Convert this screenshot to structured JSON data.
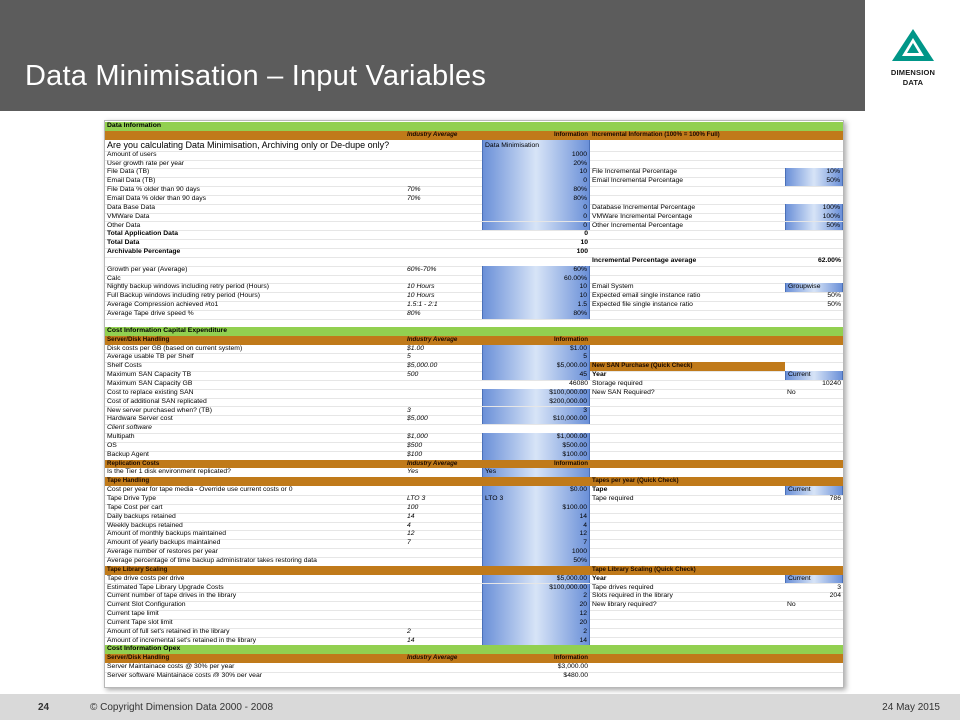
{
  "slide": {
    "title": "Data Minimisation – Input Variables",
    "logo_text_1": "DIMENSION",
    "logo_text_2": "DATA",
    "page_number": "24",
    "copyright": "© Copyright Dimension Data 2000 - 2008",
    "date": "24 May 2015"
  },
  "colors": {
    "header": "#5c5c5c",
    "green": "#92d050",
    "orange": "#c07a1a",
    "logo": "#009688"
  },
  "rows": [
    {
      "t": "g",
      "c1": "Data Information"
    },
    {
      "t": "o",
      "c2": "Industry Average",
      "c3": "Information",
      "c4": "Incremental Information (100% = 100% Full)"
    },
    {
      "t": "q",
      "c1": "Are you calculating Data Minimisation, Archiving only or De-dupe only?",
      "c3": "Data Minimisation",
      "c3b": 1,
      "c3l": 1
    },
    {
      "c1": "Amount of users",
      "c3": "1000",
      "c3b": 1
    },
    {
      "c1": "User growth rate per year",
      "c3": "20%",
      "c3b": 1
    },
    {
      "c1": "File Data (TB)",
      "c3": "10",
      "c3b": 1,
      "c4": "File Incremental Percentage",
      "c5": "10%",
      "c5b": 1
    },
    {
      "c1": "Email Data (TB)",
      "c3": "0",
      "c3b": 1,
      "c4": "Email Incremental Percentage",
      "c5": "50%",
      "c5b": 1
    },
    {
      "c1": "File Data % older than 90 days",
      "c2": "70%",
      "c3": "80%",
      "c3b": 1
    },
    {
      "c1": "Email Data % older than 90 days",
      "c2": "70%",
      "c3": "80%",
      "c3b": 1
    },
    {
      "c1": "Data Base Data",
      "c3": "0",
      "c3b": 1,
      "c4": "Database Incremental Percentage",
      "c5": "100%",
      "c5b": 1
    },
    {
      "c1": "VMWare Data",
      "c3": "0",
      "c3b": 1,
      "c4": "VMWare Incremental Percentage",
      "c5": "100%",
      "c5b": 1
    },
    {
      "c1": "Other Data",
      "c3": "0",
      "c3b": 1,
      "c4": "Other Incremental Percentage",
      "c5": "50%",
      "c5b": 1
    },
    {
      "c1": "Total Application Data",
      "c3": "0",
      "bold": 1
    },
    {
      "c1": "Total Data",
      "c3": "10",
      "bold": 1
    },
    {
      "c1": "Archivable Percentage",
      "c3": "100",
      "bold": 1
    },
    {
      "c4": "Incremental Percentage average",
      "c5": "62.00%",
      "bold": 1
    },
    {
      "c1": "Growth per year (Average)",
      "c2": "60%-70%",
      "c3": "60%",
      "c3b": 1
    },
    {
      "c1": "Calc",
      "c3": "60.00%",
      "c3b": 1
    },
    {
      "c1": "Nightly backup windows including retry period (Hours)",
      "c2": "10 Hours",
      "c3": "10",
      "c3b": 1,
      "c4": "Email System",
      "c5": "Groupwise",
      "c5b": 1,
      "c5l": 1
    },
    {
      "c1": "Full Backup windows including retry period (Hours)",
      "c2": "10 Hours",
      "c3": "10",
      "c3b": 1,
      "c4": "Expected email single instance ratio",
      "c5": "50%"
    },
    {
      "c1": "Average Compression achieved #to1",
      "c2": "1.5:1 - 2:1",
      "c3": "1.5",
      "c3b": 1,
      "c4": "Expected file single instance ratio",
      "c5": "50%"
    },
    {
      "c1": "Average Tape drive speed %",
      "c2": "80%",
      "c3": "80%",
      "c3b": 1
    },
    {},
    {
      "t": "g",
      "c1": "Cost Information Capital Expenditure"
    },
    {
      "t": "o",
      "c1": "Server/Disk Handling",
      "c2": "Industry Average",
      "c3": "Information"
    },
    {
      "c1": "Disk costs per GB (based on current system)",
      "c2": "$1.00",
      "c3": "$1.00",
      "c3b": 1
    },
    {
      "c1": "Average usable TB per Shelf",
      "c2": "5",
      "c3": "5",
      "c3b": 1
    },
    {
      "c1": "Shelf Costs",
      "c2": "$5,000.00",
      "c3": "$5,000.00",
      "c3b": 1,
      "c4": "New SAN Purchase (Quick Check)",
      "c4o": 1
    },
    {
      "c1": "Maximum SAN Capacity TB",
      "c2": "500",
      "c3": "45",
      "c3b": 1,
      "c4": "Year",
      "c4bold": 1,
      "c5": "Current",
      "c5b": 1,
      "c5l": 1
    },
    {
      "c1": "Maximum SAN Capacity GB",
      "c3": "46080",
      "c4": "Storage required",
      "c5": "10240"
    },
    {
      "c1": "Cost to replace existing SAN",
      "c3": "$100,000.00",
      "c3b": 1,
      "c4": "New SAN Required?",
      "c5": "No",
      "c5l": 1
    },
    {
      "c1": "Cost of additional SAN replicated",
      "c3": "$200,000.00",
      "c3b": 1
    },
    {
      "c1": "New server purchased when? (TB)",
      "c2": "3",
      "c3": "3",
      "c3b": 1
    },
    {
      "c1": "Hardware Server cost",
      "c2": "$5,000",
      "c3": "$10,000.00",
      "c3b": 1
    },
    {
      "c1": "Client software",
      "c1i": 1
    },
    {
      "c1": "Multipath",
      "c2": "$1,000",
      "c3": "$1,000.00",
      "c3b": 1
    },
    {
      "c1": "OS",
      "c2": "$500",
      "c3": "$500.00",
      "c3b": 1
    },
    {
      "c1": "Backup Agent",
      "c2": "$100",
      "c3": "$100.00",
      "c3b": 1
    },
    {
      "t": "o",
      "c1": "Replication Costs",
      "c2": "Industry Average",
      "c3": "Information"
    },
    {
      "c1": "Is the Tier 1 disk environment replicated?",
      "c2": "Yes",
      "c3": "Yes",
      "c3b": 1,
      "c3l": 1
    },
    {
      "t": "o",
      "c1": "Tape Handling",
      "c4": "Tapes per year (Quick Check)"
    },
    {
      "c1": "Cost per year for tape media - Override use current costs or 0",
      "c3": "$0.00",
      "c3b": 1,
      "c4": "Tape",
      "c4bold": 1,
      "c5": "Current",
      "c5b": 1,
      "c5l": 1
    },
    {
      "c1": "Tape Drive Type",
      "c2": "LTO 3",
      "c3": "LTO 3",
      "c3b": 1,
      "c3l": 1,
      "c4": "Tape required",
      "c5": "786"
    },
    {
      "c1": "Tape Cost per cart",
      "c2": "100",
      "c3": "$100.00",
      "c3b": 1
    },
    {
      "c1": "Daily backups retained",
      "c2": "14",
      "c3": "14",
      "c3b": 1
    },
    {
      "c1": "Weekly backups retained",
      "c2": "4",
      "c3": "4",
      "c3b": 1
    },
    {
      "c1": "Amount of monthly backups maintained",
      "c2": "12",
      "c3": "12",
      "c3b": 1
    },
    {
      "c1": "Amount of yearly backups maintained",
      "c2": "7",
      "c3": "7",
      "c3b": 1
    },
    {
      "c1": "Average number of restores per year",
      "c3": "1000",
      "c3b": 1
    },
    {
      "c1": "Average percentage of time backup administrator takes restoring data",
      "c3": "50%",
      "c3b": 1
    },
    {
      "t": "o",
      "c1": "Tape Library Scaling",
      "c4": "Tape Library Scaling (Quick Check)"
    },
    {
      "c1": "Tape drive costs per drive",
      "c3": "$5,000.00",
      "c3b": 1,
      "c4": "Year",
      "c4bold": 1,
      "c5": "Current",
      "c5b": 1,
      "c5l": 1
    },
    {
      "c1": "Estimated Tape Library Upgrade Costs",
      "c3": "$100,000.00",
      "c3b": 1,
      "c4": "Tape drives required",
      "c5": "3"
    },
    {
      "c1": "Current number of tape drives in the library",
      "c3": "2",
      "c3b": 1,
      "c4": "Slots required in the library",
      "c5": "204"
    },
    {
      "c1": "Current Slot Configuration",
      "c3": "20",
      "c3b": 1,
      "c4": "New library required?",
      "c5": "No",
      "c5l": 1
    },
    {
      "c1": "Current tape limit",
      "c3": "12",
      "c3b": 1
    },
    {
      "c1": "Current Tape slot limit",
      "c3": "20",
      "c3b": 1
    },
    {
      "c1": "Amount of full set's retained in the library",
      "c2": "2",
      "c3": "2",
      "c3b": 1
    },
    {
      "c1": "Amount of incremental set's retained in the library",
      "c2": "14",
      "c3": "14",
      "c3b": 1
    },
    {
      "t": "g",
      "c1": "Cost Information Opex"
    },
    {
      "t": "o",
      "c1": "Server/Disk Handling",
      "c2": "Industry Average",
      "c3": "Information"
    },
    {
      "c1": "Server Maintainace costs @ 30% per year",
      "c3": "$3,000.00"
    },
    {
      "c1": "Server software Maintainace costs @ 30% per year",
      "c3": "$480.00"
    }
  ]
}
